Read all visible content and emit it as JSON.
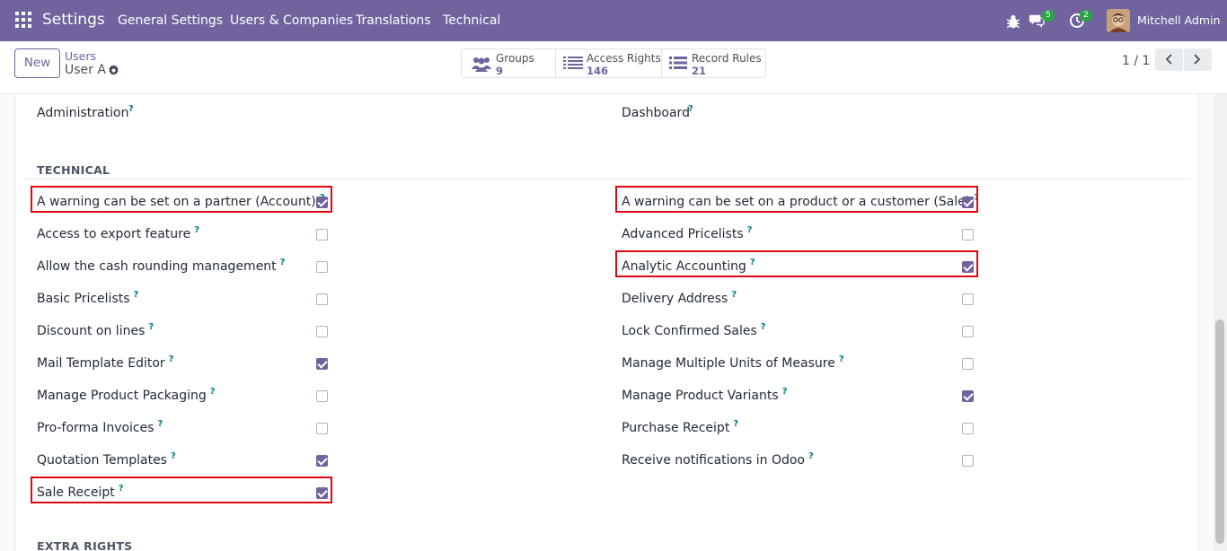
{
  "navbar": {
    "brand": "Settings",
    "menu": [
      "General Settings",
      "Users & Companies",
      "Translations",
      "Technical"
    ],
    "messages_count": "5",
    "activities_count": "2",
    "user_name": "Mitchell Admin"
  },
  "control": {
    "new_label": "New",
    "breadcrumb_parent": "Users",
    "breadcrumb_current": "User A",
    "stats": [
      {
        "label": "Groups",
        "value": "9"
      },
      {
        "label": "Access Rights",
        "value": "146"
      },
      {
        "label": "Record Rules",
        "value": "21"
      }
    ],
    "pager": "1 / 1"
  },
  "top_fields": {
    "left": "Administration",
    "right": "Dashboard"
  },
  "help_mark": "?",
  "technical": {
    "title": "TECHNICAL",
    "left": [
      {
        "label": "A warning can be set on a partner (Account)",
        "checked": true,
        "highlighted": true
      },
      {
        "label": "Access to export feature",
        "checked": false
      },
      {
        "label": "Allow the cash rounding management",
        "checked": false
      },
      {
        "label": "Basic Pricelists",
        "checked": false
      },
      {
        "label": "Discount on lines",
        "checked": false
      },
      {
        "label": "Mail Template Editor",
        "checked": true
      },
      {
        "label": "Manage Product Packaging",
        "checked": false
      },
      {
        "label": "Pro-forma Invoices",
        "checked": false
      },
      {
        "label": "Quotation Templates",
        "checked": true
      },
      {
        "label": "Sale Receipt",
        "checked": true,
        "highlighted": true
      }
    ],
    "right": [
      {
        "label": "A warning can be set on a product or a customer (Sale)",
        "checked": true,
        "highlighted": true
      },
      {
        "label": "Advanced Pricelists",
        "checked": false
      },
      {
        "label": "Analytic Accounting",
        "checked": true,
        "highlighted": true
      },
      {
        "label": "Delivery Address",
        "checked": false
      },
      {
        "label": "Lock Confirmed Sales",
        "checked": false
      },
      {
        "label": "Manage Multiple Units of Measure",
        "checked": false
      },
      {
        "label": "Manage Product Variants",
        "checked": true
      },
      {
        "label": "Purchase Receipt",
        "checked": false
      },
      {
        "label": "Receive notifications in Odoo",
        "checked": false
      }
    ]
  },
  "extra_rights": {
    "title": "EXTRA RIGHTS"
  },
  "colors": {
    "brand": "#71639e",
    "highlight": "#e30613",
    "help": "#017e84"
  }
}
